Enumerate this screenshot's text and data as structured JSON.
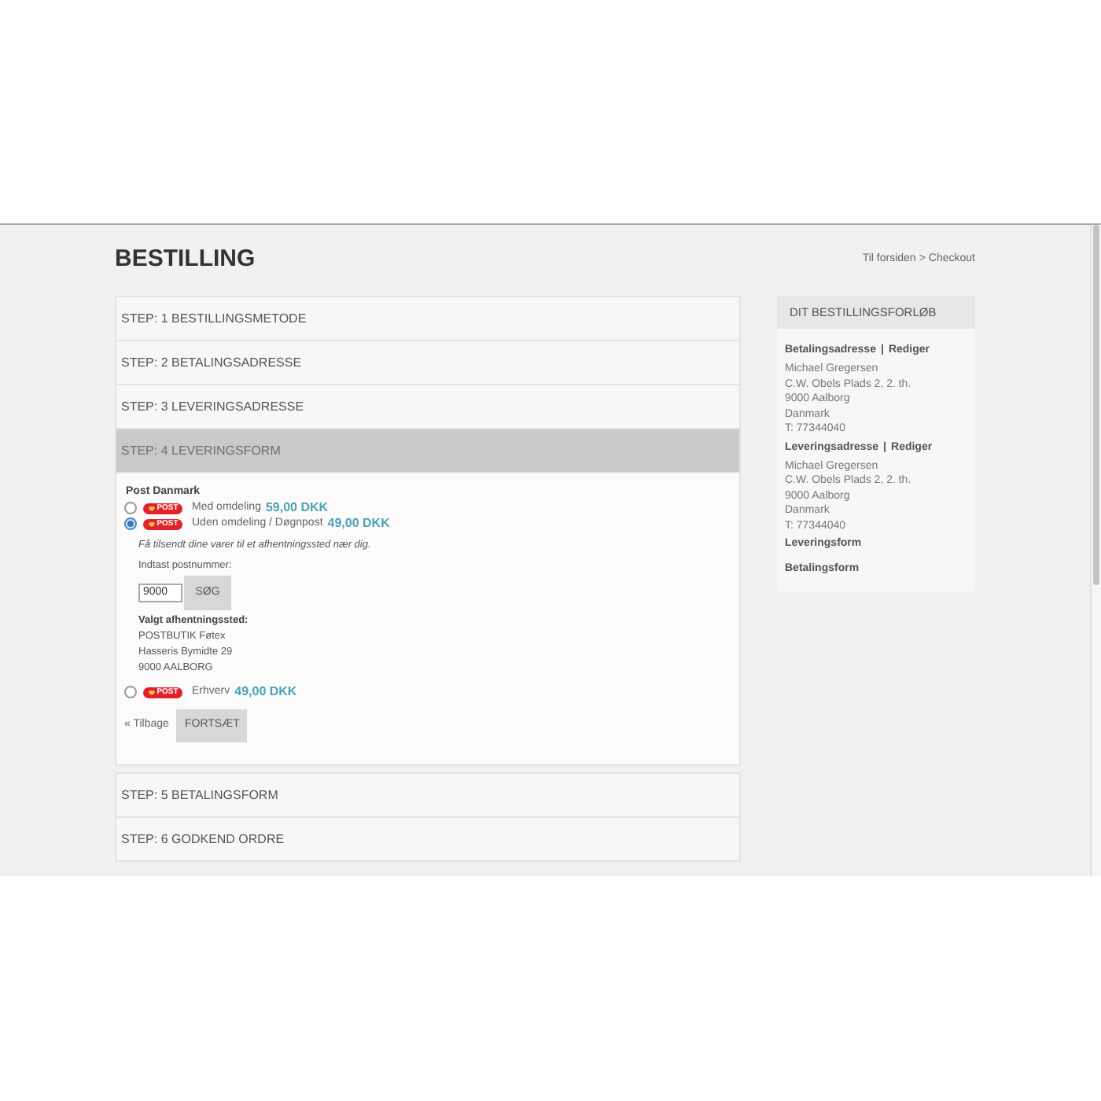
{
  "title": "BESTILLING",
  "breadcrumb": {
    "items": [
      "Til forsiden",
      "Checkout"
    ],
    "separator": ">"
  },
  "steps": [
    {
      "label": "STEP: 1 BESTILLINGSMETODE",
      "expanded": false
    },
    {
      "label": "STEP: 2 BETALINGSADRESSE",
      "expanded": false
    },
    {
      "label": "STEP: 3 LEVERINGSADRESSE",
      "expanded": false
    },
    {
      "label": "STEP: 4 LEVERINGSFORM",
      "expanded": true,
      "form": {
        "carrier": "Post Danmark",
        "options": [
          {
            "logo_text": "POST",
            "label": "Med omdeling",
            "price": "59,00 DKK",
            "selected": false
          },
          {
            "logo_text": "POST",
            "label": "Uden omdeling / Døgnpost",
            "price": "49,00 DKK",
            "selected": true,
            "details": {
              "note": "Få tilsendt dine varer til et afhentningssted nær dig.",
              "postcode_label": "Indtast postnummer:",
              "postcode_value": "9000",
              "search_button": "SØG",
              "pickup_heading": "Valgt afhentningssted:",
              "pickup_lines": [
                "POSTBUTIK Føtex",
                "Hasseris Bymidte 29",
                "9000 AALBORG"
              ]
            }
          },
          {
            "logo_text": "POST",
            "label": "Erhverv",
            "price": "49,00 DKK",
            "selected": false
          }
        ],
        "back_link": "« Tilbage",
        "continue_button": "FORTSÆT"
      }
    },
    {
      "label": "STEP: 5 BETALINGSFORM",
      "expanded": false
    },
    {
      "label": "STEP: 6 GODKEND ORDRE",
      "expanded": false
    }
  ],
  "sidebar": {
    "title": "DIT BESTILLINGSFORLØB",
    "sections": [
      {
        "heading": "Betalingsadresse",
        "separator": "|",
        "action": "Rediger",
        "lines": [
          "Michael Gregersen",
          "C.W. Obels Plads 2, 2. th.",
          "9000 Aalborg",
          "Danmark",
          "T: 77344040"
        ]
      },
      {
        "heading": "Leveringsadresse",
        "separator": "|",
        "action": "Rediger",
        "lines": [
          "Michael Gregersen",
          "C.W. Obels Plads 2, 2. th.",
          "9000 Aalborg",
          "Danmark",
          "T: 77344040"
        ]
      },
      {
        "heading": "Leveringsform"
      },
      {
        "heading": "Betalingsform"
      }
    ]
  }
}
